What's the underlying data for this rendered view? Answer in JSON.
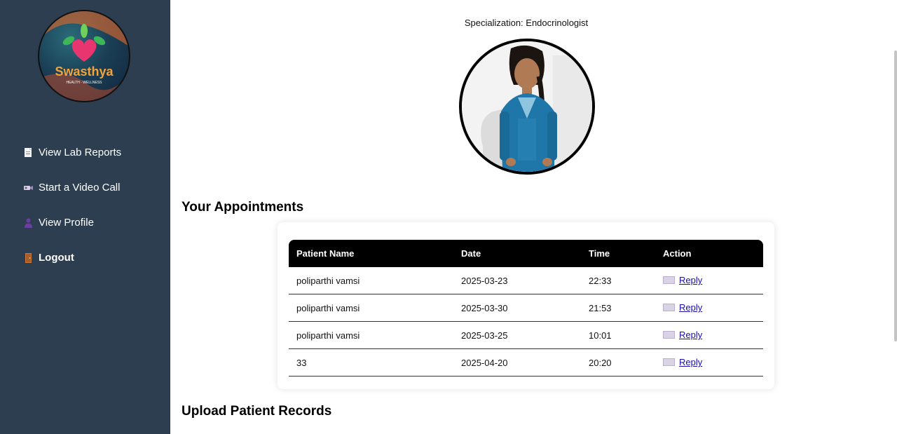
{
  "sidebar": {
    "logo": {
      "brand": "Swasthya",
      "tagline": "HEALTH · WELLNESS"
    },
    "items": [
      {
        "label": "View Lab Reports",
        "icon": "document-icon"
      },
      {
        "label": "Start a Video Call",
        "icon": "video-camera-icon"
      },
      {
        "label": "View Profile",
        "icon": "person-icon"
      },
      {
        "label": "Logout",
        "icon": "door-icon"
      }
    ]
  },
  "profile": {
    "specialization": "Specialization: Endocrinologist"
  },
  "appointments": {
    "heading": "Your Appointments",
    "columns": [
      "Patient Name",
      "Date",
      "Time",
      "Action"
    ],
    "rows": [
      {
        "patient": "poliparthi vamsi",
        "date": "2025-03-23",
        "time": "22:33",
        "action": "Reply"
      },
      {
        "patient": "poliparthi vamsi",
        "date": "2025-03-30",
        "time": "21:53",
        "action": "Reply"
      },
      {
        "patient": "poliparthi vamsi",
        "date": "2025-03-25",
        "time": "10:01",
        "action": "Reply"
      },
      {
        "patient": "33",
        "date": "2025-04-20",
        "time": "20:20",
        "action": "Reply"
      }
    ]
  },
  "upload": {
    "heading": "Upload Patient Records"
  },
  "colors": {
    "sidebar_bg": "#2c3e50",
    "table_header_bg": "#000000",
    "link": "#1a0dab"
  }
}
